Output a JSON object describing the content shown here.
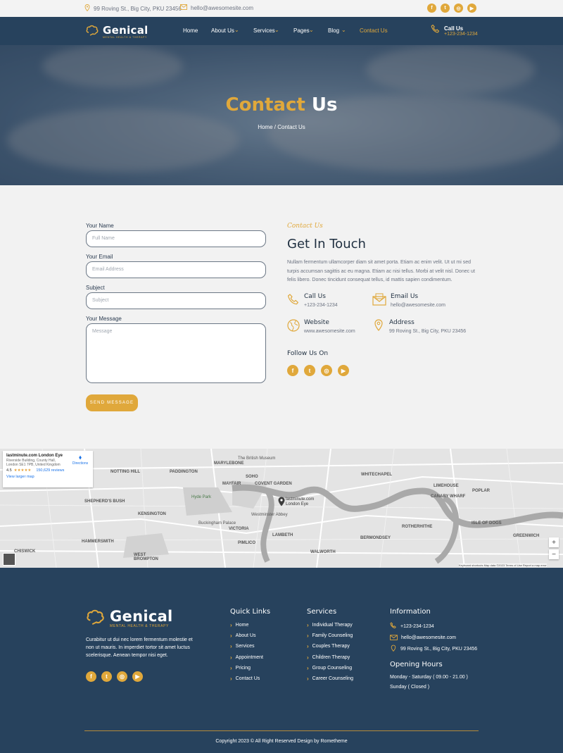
{
  "topbar": {
    "address": "99 Roving St., Big City, PKU 23456",
    "email": "hello@awesomesite.com",
    "social": [
      {
        "icon": "facebook-icon",
        "glyph": "f"
      },
      {
        "icon": "twitter-icon",
        "glyph": "t"
      },
      {
        "icon": "instagram-icon",
        "glyph": "◎"
      },
      {
        "icon": "youtube-icon",
        "glyph": "▶"
      }
    ]
  },
  "header": {
    "brand": "Genical",
    "tagline": "MENTAL HEALTH & THERAPY",
    "nav": [
      {
        "label": "Home",
        "dropdown": false,
        "active": false
      },
      {
        "label": "About Us",
        "dropdown": true,
        "active": false
      },
      {
        "label": "Services",
        "dropdown": true,
        "active": false
      },
      {
        "label": "Pages",
        "dropdown": true,
        "active": false
      },
      {
        "label": "Blog",
        "dropdown": true,
        "active": false
      },
      {
        "label": "Contact Us",
        "dropdown": false,
        "active": true
      }
    ],
    "call_title": "Call Us",
    "call_number": "+123-234-1234"
  },
  "hero": {
    "title_part1": "Contact",
    "title_part2": "Us",
    "breadcrumb": "Home / Contact Us"
  },
  "form": {
    "name_label": "Your Name",
    "name_placeholder": "Full Name",
    "email_label": "Your Email",
    "email_placeholder": "Email Address",
    "subject_label": "Subject",
    "subject_placeholder": "Subject",
    "message_label": "Your Message",
    "message_placeholder": "Message",
    "send_label": "SEND MESSAGE"
  },
  "contact": {
    "eyebrow": "Contact Us",
    "title": "Get In Touch",
    "text": "Nullam fermentum ullamcorper diam sit amet porta. Etiam ac enim velit. Ut ut mi sed turpis accumsan sagittis ac eu magna. Etiam ac nisi tellus. Morbi at velit nisl. Donec ut felis libero. Donec tincidunt consequat tellus, id mattis sapien condimentum.",
    "items": [
      {
        "title": "Call Us",
        "value": "+123-234-1234",
        "icon": "phone-icon"
      },
      {
        "title": "Email Us",
        "value": "hello@awesomesite.com",
        "icon": "envelope-icon"
      },
      {
        "title": "Website",
        "value": "www.awesomesite.com",
        "icon": "globe-icon"
      },
      {
        "title": "Address",
        "value": "99 Roving St., Big City, PKU 23456",
        "icon": "map-pin-icon"
      }
    ],
    "follow": "Follow Us On"
  },
  "map": {
    "place_name": "lastminute.com London Eye",
    "place_address": "Riverside Building, County Hall, London SE1 7PB, United Kingdom",
    "rating": "4.5",
    "stars": "★★★★★",
    "reviews": "150,629 reviews",
    "directions": "Directions",
    "larger_map": "View larger map",
    "pin_label": "lastminute.com London Eye",
    "zoom_in": "+",
    "zoom_out": "−",
    "attribution": "Keyboard shortcuts   Map data ©2023   Terms of Use   Report a map error",
    "labels": [
      {
        "text": "NOTTING HILL"
      },
      {
        "text": "PADDINGTON"
      },
      {
        "text": "MARYLEBONE"
      },
      {
        "text": "SOHO"
      },
      {
        "text": "MAYFAIR"
      },
      {
        "text": "COVENT GARDEN"
      },
      {
        "text": "WHITECHAPEL"
      },
      {
        "text": "LIMEHOUSE"
      },
      {
        "text": "POPLAR"
      },
      {
        "text": "CANARY WHARF"
      },
      {
        "text": "SHEPHERD'S BUSH"
      },
      {
        "text": "KENSINGTON"
      },
      {
        "text": "VICTORIA"
      },
      {
        "text": "LAMBETH"
      },
      {
        "text": "BERMONDSEY"
      },
      {
        "text": "HAMMERSMITH"
      },
      {
        "text": "PIMLICO"
      },
      {
        "text": "WALWORTH"
      },
      {
        "text": "GREENWICH"
      },
      {
        "text": "ISLE OF DOGS"
      },
      {
        "text": "ROTHERHITHE"
      },
      {
        "text": "CHISWICK"
      },
      {
        "text": "WEST BROMPTON"
      },
      {
        "text": "Hyde Park"
      },
      {
        "text": "The British Museum"
      },
      {
        "text": "Westminster Abbey"
      },
      {
        "text": "Buckingham Palace"
      }
    ]
  },
  "footer": {
    "brand": "Genical",
    "tagline": "MENTAL HEALTH & THERAPY",
    "description": "Curabitur ut dui nec lorem fermentum molestie et non ut mauris. In imperdiet tortor sit amet luctus scelerisque. Aenean tempor nisi eget.",
    "quick_links_title": "Quick Links",
    "quick_links": [
      "Home",
      "About Us",
      "Services",
      "Appointment",
      "Pricing",
      "Contact Us"
    ],
    "services_title": "Services",
    "services": [
      "Individual Therapy",
      "Family Counseling",
      "Couples Therapy",
      "Children Therapy",
      "Group Counseling",
      "Career Counseling"
    ],
    "info_title": "Information",
    "info": [
      {
        "icon": "phone-icon",
        "text": "+123-234-1234"
      },
      {
        "icon": "envelope-icon",
        "text": "hello@awesomesite.com"
      },
      {
        "icon": "map-pin-icon",
        "text": "99 Roving St., Big City, PKU 23456"
      }
    ],
    "hours_title": "Opening Hours",
    "hours": [
      "Monday - Saturday ( 09.00 - 21.00 )",
      "Sunday ( Closed )"
    ],
    "copyright": "Copyright 2023 © All Right Reserved Design by Rometheme"
  },
  "colors": {
    "accent": "#e0a83b",
    "navy": "#27425d",
    "light": "#f2f2f2"
  }
}
